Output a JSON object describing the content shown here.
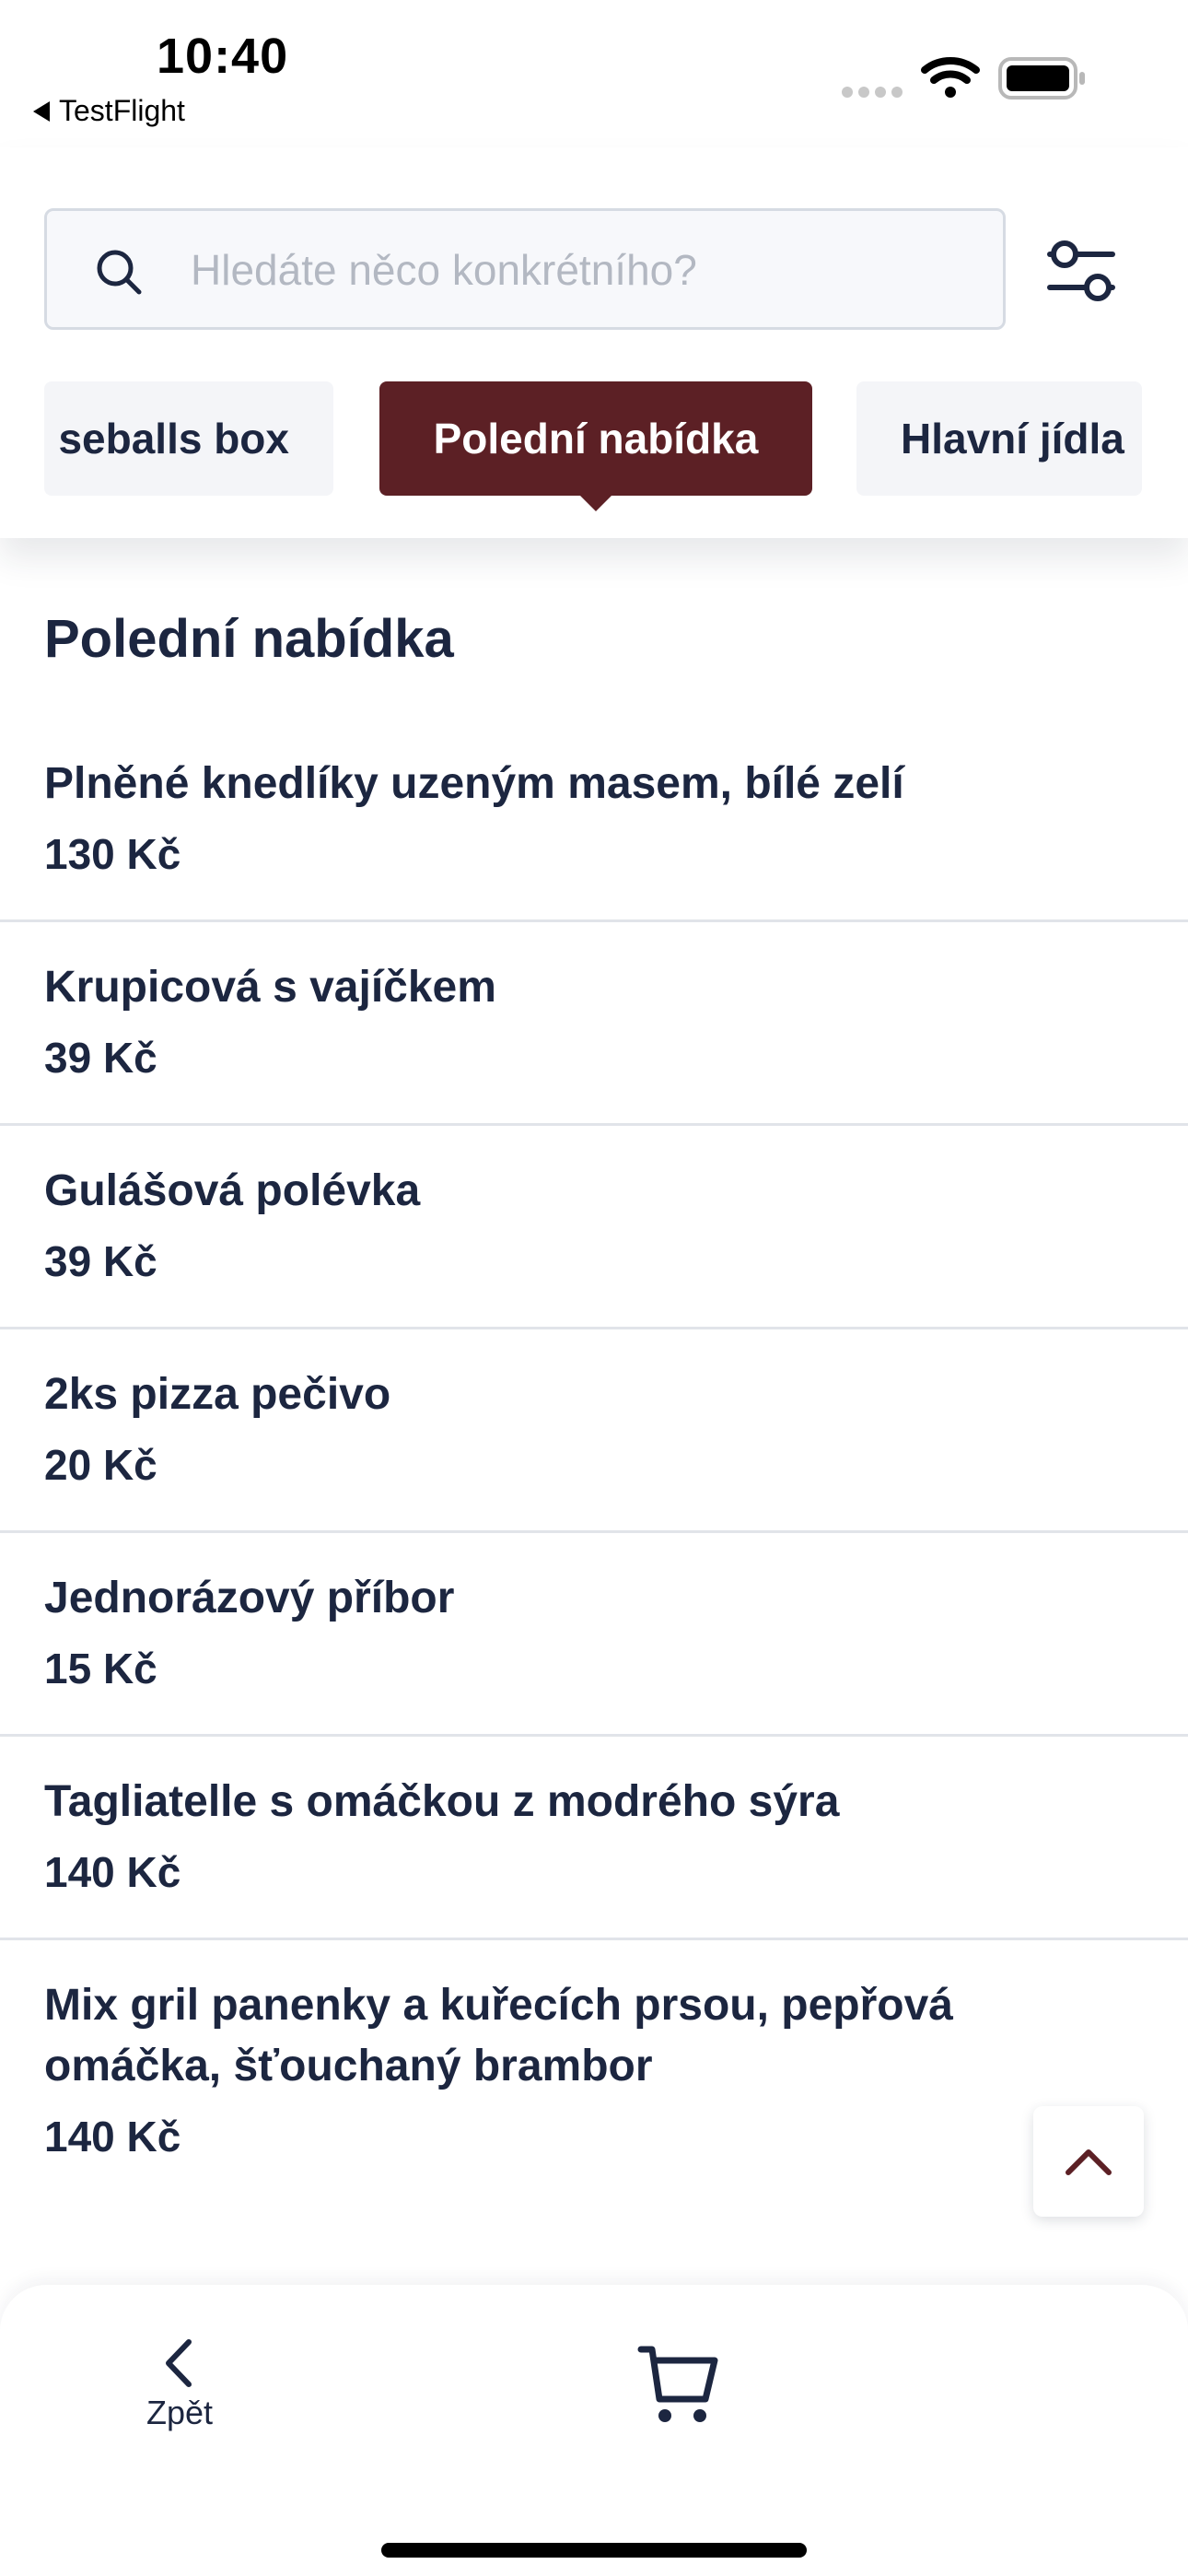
{
  "status_bar": {
    "time": "10:40",
    "back_app": "TestFlight"
  },
  "search": {
    "placeholder": "Hledáte něco konkrétního?",
    "value": ""
  },
  "tabs": [
    {
      "label": "Cheeseballs box",
      "visible_text": "seballs box",
      "active": false
    },
    {
      "label": "Polední nabídka",
      "active": true
    },
    {
      "label": "Hlavní jídla",
      "active": false
    }
  ],
  "section": {
    "title": "Polední nabídka"
  },
  "menu_items": [
    {
      "name": "Plněné knedlíky uzeným masem, bílé zelí",
      "price": "130 Kč"
    },
    {
      "name": "Krupicová s vajíčkem",
      "price": "39 Kč"
    },
    {
      "name": "Gulášová polévka",
      "price": "39 Kč"
    },
    {
      "name": "2ks pizza pečivo",
      "price": "20 Kč"
    },
    {
      "name": "Jednorázový příbor",
      "price": "15 Kč"
    },
    {
      "name": "Tagliatelle s omáčkou z modrého sýra",
      "price": "140 Kč"
    },
    {
      "name": "Mix gril panenky a kuřecích prsou, pepřová omáčka, šťouchaný brambor",
      "price": "140 Kč"
    }
  ],
  "bottom_bar": {
    "back_label": "Zpět",
    "cart_icon": "cart-icon"
  },
  "colors": {
    "accent": "#5c2025",
    "text": "#1c2640",
    "placeholder": "#b3b8c2",
    "tab_bg": "#f4f5f8"
  }
}
